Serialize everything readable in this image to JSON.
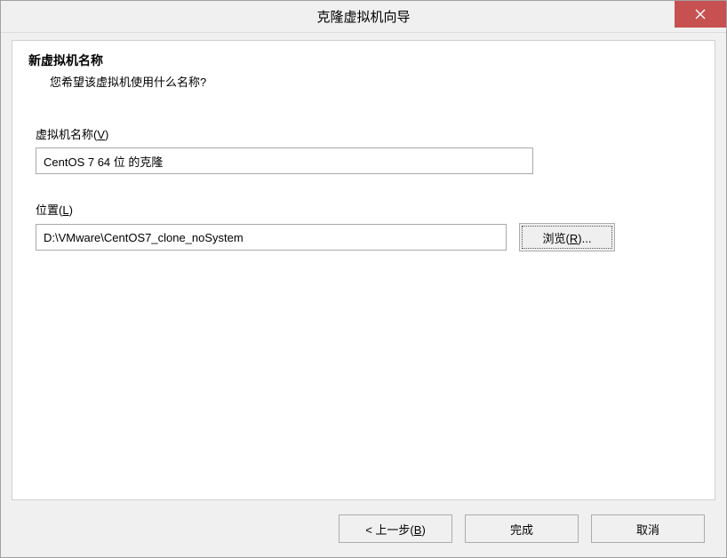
{
  "titlebar": {
    "title": "克隆虚拟机向导"
  },
  "header": {
    "title": "新虚拟机名称",
    "subtitle": "您希望该虚拟机使用什么名称?"
  },
  "fields": {
    "name": {
      "label_prefix": "虚拟机名称(",
      "label_hotkey": "V",
      "label_suffix": ")",
      "value": "CentOS 7 64 位 的克隆"
    },
    "location": {
      "label_prefix": "位置(",
      "label_hotkey": "L",
      "label_suffix": ")",
      "value": "D:\\VMware\\CentOS7_clone_noSystem",
      "browse_prefix": "浏览(",
      "browse_hotkey": "R",
      "browse_suffix": ")..."
    }
  },
  "footer": {
    "back_prefix": "< 上一步(",
    "back_hotkey": "B",
    "back_suffix": ")",
    "finish": "完成",
    "cancel": "取消"
  }
}
